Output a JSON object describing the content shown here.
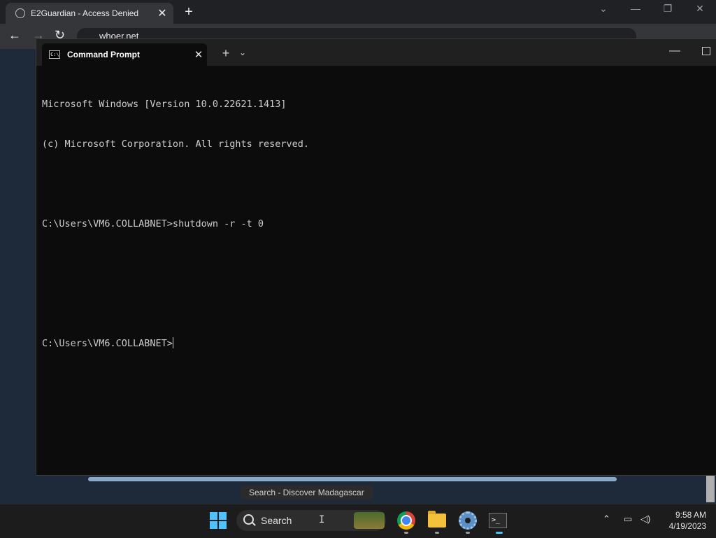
{
  "browser": {
    "tab_title": "E2Guardian - Access Denied",
    "tab_close": "✕",
    "new_tab": "+",
    "address": "whoer.net"
  },
  "terminal": {
    "tab_title": "Command Prompt",
    "tab_close": "✕",
    "new_tab": "+",
    "dropdown": "⌄",
    "lines": [
      "Microsoft Windows [Version 10.0.22621.1413]",
      "(c) Microsoft Corporation. All rights reserved.",
      "",
      "C:\\Users\\VM6.COLLABNET>shutdown -r -t 0",
      "",
      ""
    ],
    "prompt": "C:\\Users\\VM6.COLLABNET>"
  },
  "taskbar": {
    "tooltip": "Search - Discover Madagascar",
    "search_label": "Search",
    "clock_time": "9:58 AM",
    "clock_date": "4/19/2023"
  },
  "icons": {
    "start": "windows-start-icon",
    "chrome": "chrome-icon",
    "explorer": "folder-icon",
    "settings": "gear-icon",
    "terminal": "terminal-icon"
  }
}
